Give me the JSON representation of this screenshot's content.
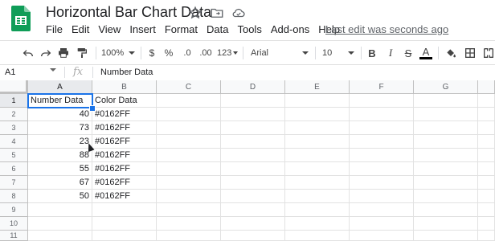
{
  "app": {
    "doc_title": "Horizontal Bar Chart Data",
    "last_edit": "Last edit was seconds ago",
    "brand_color": "#0F9D58"
  },
  "menu": [
    "File",
    "Edit",
    "View",
    "Insert",
    "Format",
    "Data",
    "Tools",
    "Add-ons",
    "Help"
  ],
  "toolbar": {
    "zoom": "100%",
    "currency": "$",
    "percent": "%",
    "decrease_decimal": ".0",
    "increase_decimal": ".00",
    "more_formats": "123",
    "font": "Arial",
    "font_size": "10",
    "bold": "B",
    "italic": "I",
    "strike": "S",
    "text_color": "A"
  },
  "formula_bar": {
    "cell_ref": "A1",
    "fx": "fx",
    "value": "Number Data"
  },
  "columns": [
    "A",
    "B",
    "C",
    "D",
    "E",
    "F",
    "G"
  ],
  "rows": [
    "1",
    "2",
    "3",
    "4",
    "5",
    "6",
    "7",
    "8",
    "9",
    "10",
    "11"
  ],
  "cells": {
    "A1": "Number Data",
    "B1": "Color Data",
    "A2": "40",
    "B2": "#0162FF",
    "A3": "73",
    "B3": "#0162FF",
    "A4": "23",
    "B4": "#0162FF",
    "A5": "88",
    "B5": "#0162FF",
    "A6": "55",
    "B6": "#0162FF",
    "A7": "67",
    "B7": "#0162FF",
    "A8": "50",
    "B8": "#0162FF"
  },
  "selection_color": "#1A73E8"
}
